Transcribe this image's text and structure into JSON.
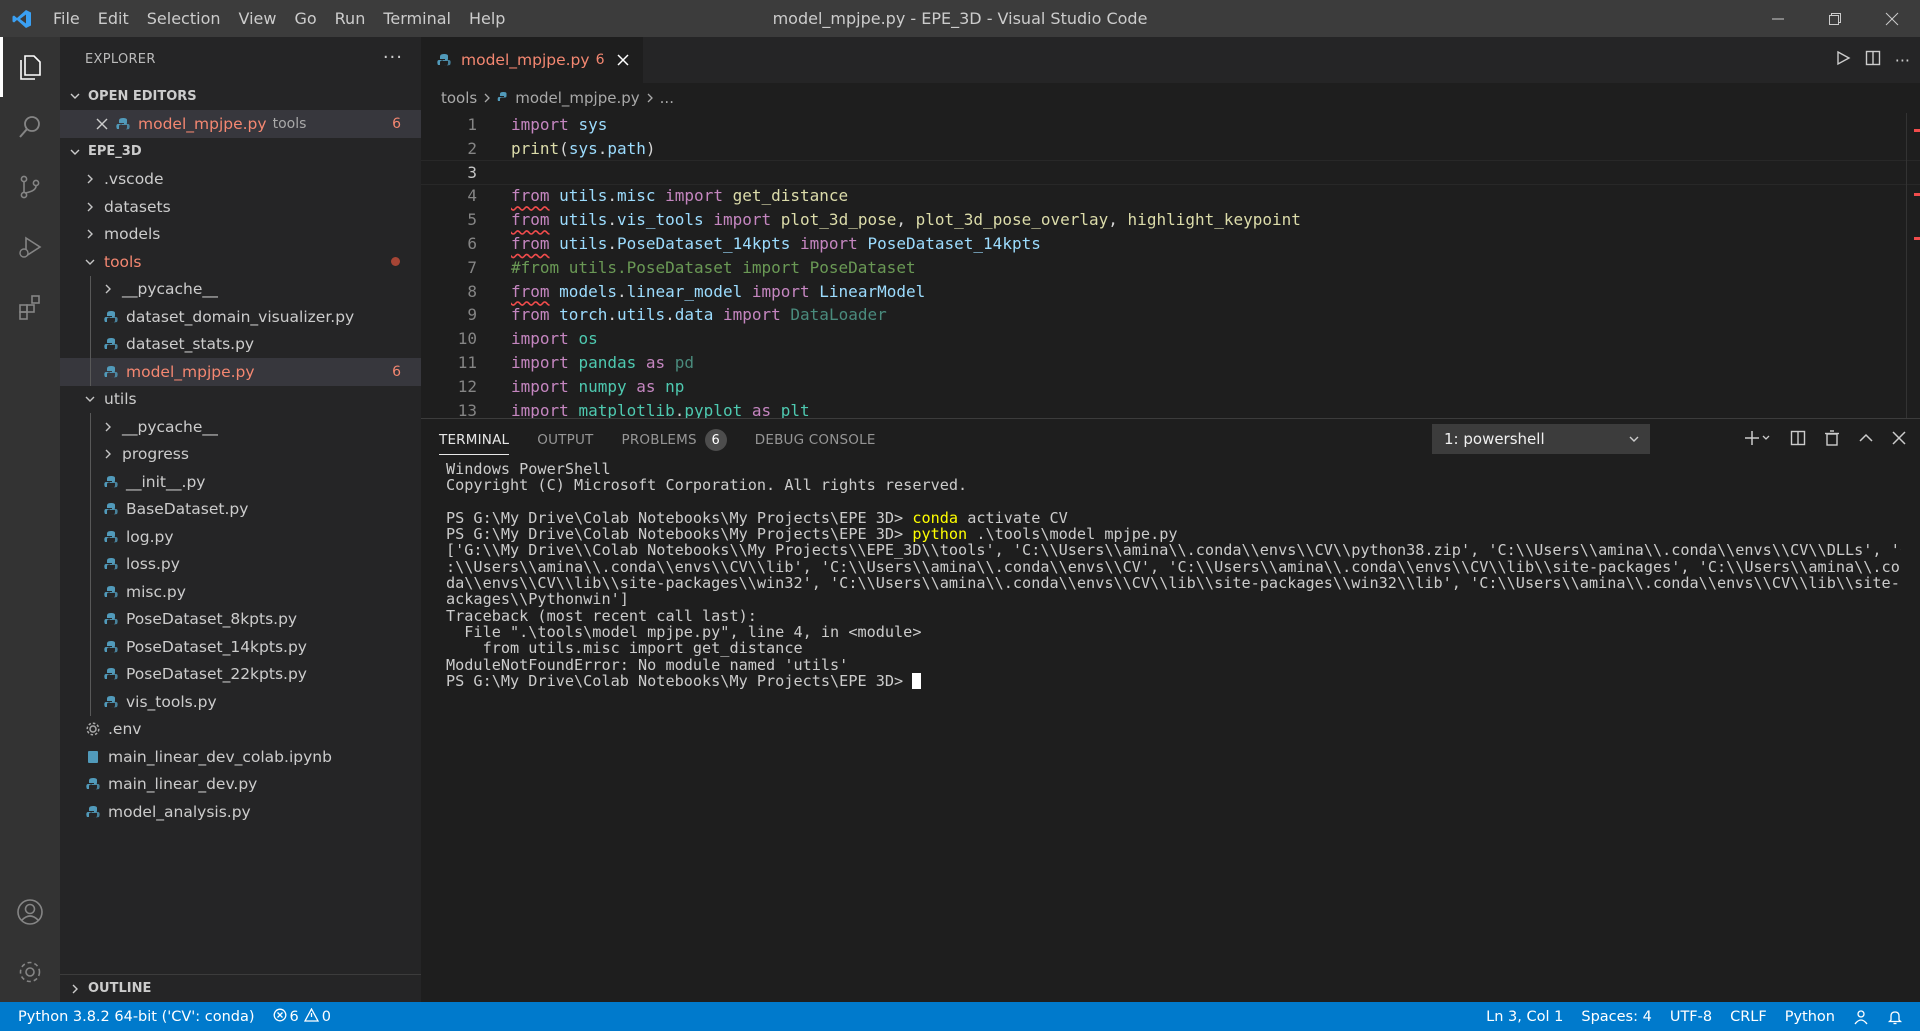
{
  "window": {
    "title": "model_mpjpe.py - EPE_3D - Visual Studio Code",
    "menu": [
      "File",
      "Edit",
      "Selection",
      "View",
      "Go",
      "Run",
      "Terminal",
      "Help"
    ]
  },
  "sidebar": {
    "header": "EXPLORER",
    "open_editors_label": "OPEN EDITORS",
    "open_editor": {
      "name": "model_mpjpe.py",
      "folder": "tools",
      "problems": "6"
    },
    "workspace_label": "EPE_3D",
    "tree": [
      {
        "label": ".vscode",
        "type": "folder-collapsed",
        "depth": 0
      },
      {
        "label": "datasets",
        "type": "folder-collapsed",
        "depth": 0
      },
      {
        "label": "models",
        "type": "folder-collapsed",
        "depth": 0
      },
      {
        "label": "tools",
        "type": "folder-open",
        "depth": 0,
        "error": true
      },
      {
        "label": "__pycache__",
        "type": "folder-collapsed",
        "depth": 1
      },
      {
        "label": "dataset_domain_visualizer.py",
        "type": "py",
        "depth": 1
      },
      {
        "label": "dataset_stats.py",
        "type": "py",
        "depth": 1
      },
      {
        "label": "model_mpjpe.py",
        "type": "py",
        "depth": 1,
        "selected": true,
        "problems": "6"
      },
      {
        "label": "utils",
        "type": "folder-open",
        "depth": 0
      },
      {
        "label": "__pycache__",
        "type": "folder-collapsed",
        "depth": 1
      },
      {
        "label": "progress",
        "type": "folder-collapsed",
        "depth": 1
      },
      {
        "label": "__init__.py",
        "type": "py",
        "depth": 1
      },
      {
        "label": "BaseDataset.py",
        "type": "py",
        "depth": 1
      },
      {
        "label": "log.py",
        "type": "py",
        "depth": 1
      },
      {
        "label": "loss.py",
        "type": "py",
        "depth": 1
      },
      {
        "label": "misc.py",
        "type": "py",
        "depth": 1
      },
      {
        "label": "PoseDataset_8kpts.py",
        "type": "py",
        "depth": 1
      },
      {
        "label": "PoseDataset_14kpts.py",
        "type": "py",
        "depth": 1
      },
      {
        "label": "PoseDataset_22kpts.py",
        "type": "py",
        "depth": 1
      },
      {
        "label": "vis_tools.py",
        "type": "py",
        "depth": 1
      },
      {
        "label": ".env",
        "type": "env",
        "depth": 0
      },
      {
        "label": "main_linear_dev_colab.ipynb",
        "type": "nb",
        "depth": 0
      },
      {
        "label": "main_linear_dev.py",
        "type": "py",
        "depth": 0
      },
      {
        "label": "model_analysis.py",
        "type": "py",
        "depth": 0
      }
    ],
    "outline_label": "OUTLINE"
  },
  "editor": {
    "tab": {
      "name": "model_mpjpe.py",
      "problems": "6"
    },
    "breadcrumb": [
      "tools",
      "model_mpjpe.py",
      "..."
    ],
    "current_line": 3
  },
  "panel": {
    "tabs": [
      "TERMINAL",
      "OUTPUT",
      "PROBLEMS",
      "DEBUG CONSOLE"
    ],
    "problems_count": "6",
    "terminal_select": "1: powershell",
    "terminal_lines": [
      {
        "text": "Windows PowerShell"
      },
      {
        "text": "Copyright (C) Microsoft Corporation. All rights reserved."
      },
      {
        "text": ""
      },
      {
        "prompt": "PS G:\\My Drive\\Colab Notebooks\\My Projects\\EPE_3D> ",
        "cmd": "conda",
        "rest": " activate CV"
      },
      {
        "prompt": "PS G:\\My Drive\\Colab Notebooks\\My Projects\\EPE_3D> ",
        "cmd": "python",
        "rest": " .\\tools\\model_mpjpe.py"
      },
      {
        "text": "['G:\\\\My Drive\\\\Colab Notebooks\\\\My Projects\\\\EPE_3D\\\\tools', 'C:\\\\Users\\\\amina\\\\.conda\\\\envs\\\\CV\\\\python38.zip', 'C:\\\\Users\\\\amina\\\\.conda\\\\envs\\\\CV\\\\DLLs', 'C"
      },
      {
        "text": ":\\\\Users\\\\amina\\\\.conda\\\\envs\\\\CV\\\\lib', 'C:\\\\Users\\\\amina\\\\.conda\\\\envs\\\\CV', 'C:\\\\Users\\\\amina\\\\.conda\\\\envs\\\\CV\\\\lib\\\\site-packages', 'C:\\\\Users\\\\amina\\\\.con"
      },
      {
        "text": "da\\\\envs\\\\CV\\\\lib\\\\site-packages\\\\win32', 'C:\\\\Users\\\\amina\\\\.conda\\\\envs\\\\CV\\\\lib\\\\site-packages\\\\win32\\\\lib', 'C:\\\\Users\\\\amina\\\\.conda\\\\envs\\\\CV\\\\lib\\\\site-p"
      },
      {
        "text": "ackages\\\\Pythonwin']"
      },
      {
        "text": "Traceback (most recent call last):"
      },
      {
        "text": "  File \".\\tools\\model_mpjpe.py\", line 4, in <module>"
      },
      {
        "text": "    from utils.misc import get_distance"
      },
      {
        "text": "ModuleNotFoundError: No module named 'utils'"
      },
      {
        "prompt": "PS G:\\My Drive\\Colab Notebooks\\My Projects\\EPE_3D> ",
        "cursor": true
      }
    ]
  },
  "statusbar": {
    "interpreter": "Python 3.8.2 64-bit ('CV': conda)",
    "errors": "6",
    "warnings": "0",
    "position": "Ln 3, Col 1",
    "spaces": "Spaces: 4",
    "encoding": "UTF-8",
    "eol": "CRLF",
    "language": "Python"
  },
  "colors": {
    "accent": "#007acc",
    "error": "#f48771",
    "keyword": "#c586c0",
    "module": "#9cdcfe",
    "function": "#dcdcaa",
    "class": "#4ec9b0",
    "comment": "#6a9955"
  }
}
